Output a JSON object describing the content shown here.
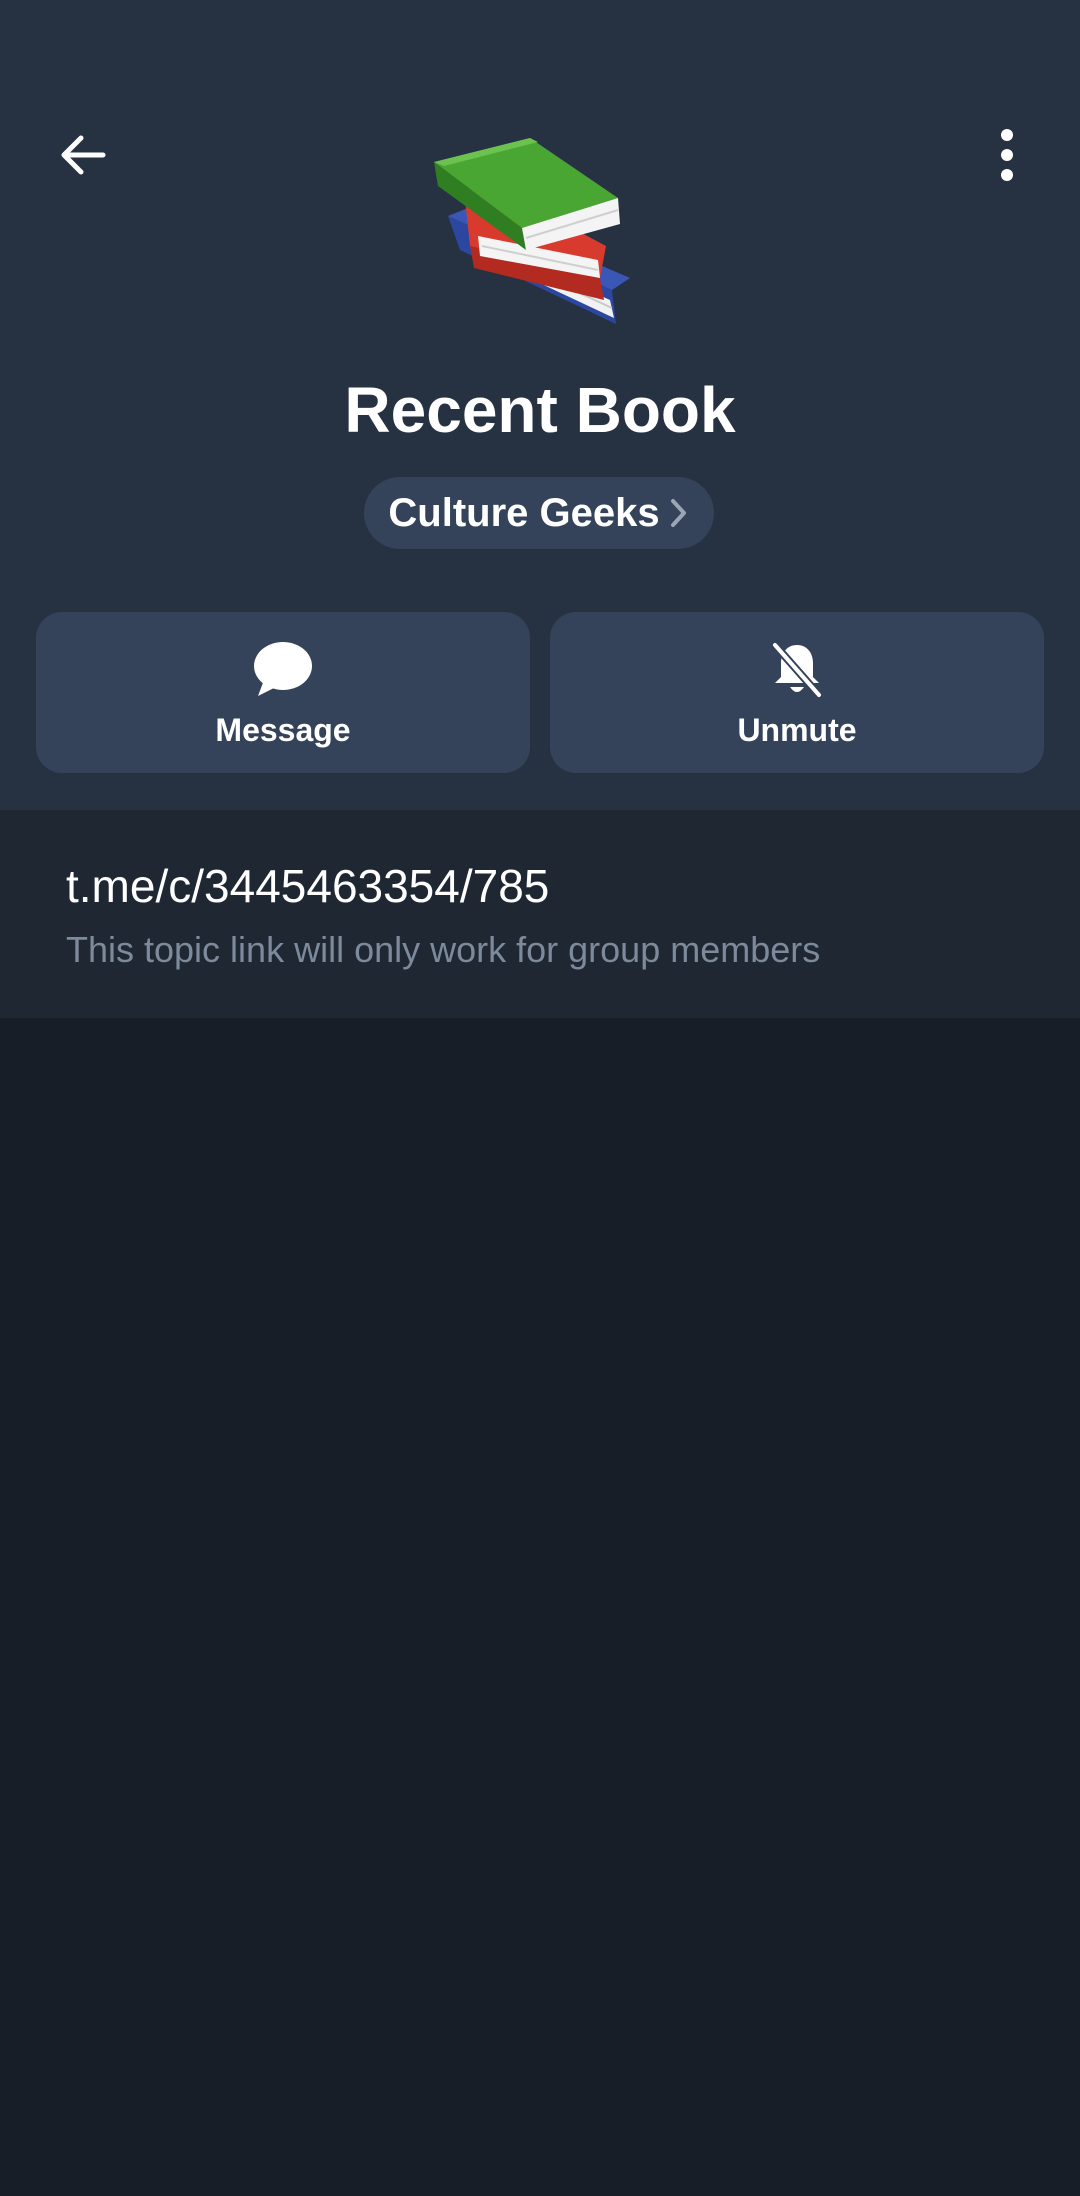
{
  "header": {
    "title": "Recent Book",
    "group_name": "Culture Geeks",
    "topic_icon": "books-emoji-icon"
  },
  "actions": [
    {
      "label": "Message",
      "icon": "chat-bubble-icon"
    },
    {
      "label": "Unmute",
      "icon": "bell-off-icon"
    }
  ],
  "link": {
    "url": "t.me/c/3445463354/785",
    "note": "This topic link will only work for group members"
  },
  "colors": {
    "header_bg": "#263142",
    "button_bg": "#34435a",
    "page_bg": "#181e28",
    "link_section_bg": "#1f2733",
    "muted_text": "#7d8a9b"
  }
}
